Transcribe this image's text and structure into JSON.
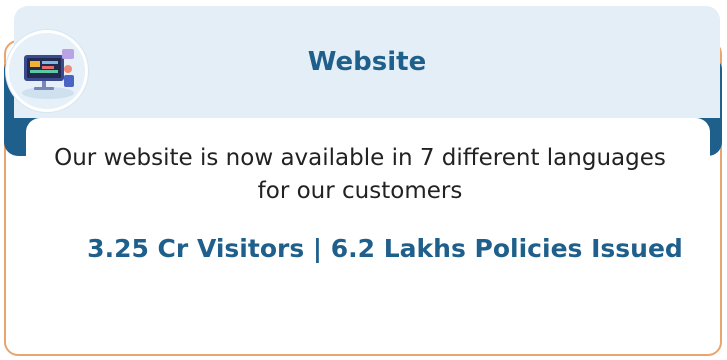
{
  "card": {
    "title": "Website",
    "description": "Our website is now available in 7 different languages for our customers",
    "stats": "3.25 Cr Visitors  | 6.2 Lakhs Policies Issued",
    "icon": "website-illustration-icon"
  },
  "colors": {
    "title": "#1f5f8b",
    "header_bg": "#e3eef7",
    "border": "#e8a56f",
    "navy": "#1f5f8b"
  }
}
